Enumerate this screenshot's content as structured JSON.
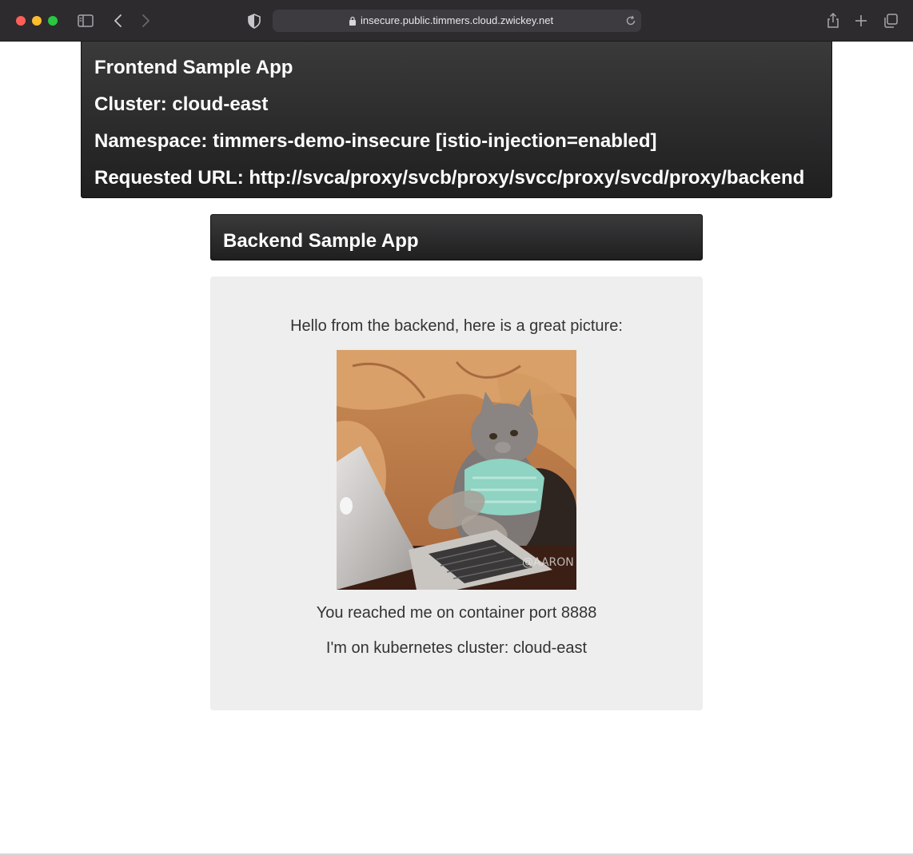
{
  "browser": {
    "url": "insecure.public.timmers.cloud.zwickey.net",
    "icons": [
      "sidebar-icon",
      "back-icon",
      "forward-icon",
      "shield-icon",
      "lock-icon",
      "reload-icon",
      "share-icon",
      "new-tab-icon",
      "tabs-overview-icon"
    ]
  },
  "frontend": {
    "title": "Frontend Sample App",
    "cluster": "Cluster: cloud-east",
    "namespace": "Namespace: timmers-demo-insecure [istio-injection=enabled]",
    "requested_url": "Requested URL: http://svca/proxy/svcb/proxy/svcc/proxy/svcd/proxy/backend"
  },
  "backend": {
    "title": "Backend Sample App",
    "greeting": "Hello from the backend, here is a great picture:",
    "image_watermark": "@AARON",
    "port_text": "You reached me on container port 8888",
    "cluster_text": "I'm on kubernetes cluster: cloud-east"
  },
  "colors": {
    "header_dark": "#2b2b2c",
    "card_bg": "#eeeeee",
    "chrome_bg": "#2e2b2f"
  }
}
